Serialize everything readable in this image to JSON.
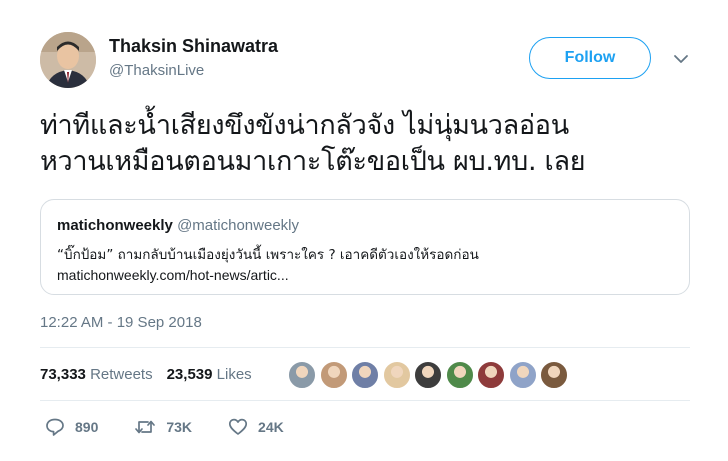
{
  "author": {
    "name": "Thaksin Shinawatra",
    "handle": "@ThaksinLive",
    "avatar_icon": "profile-photo"
  },
  "follow_label": "Follow",
  "tweet": {
    "lines": [
      "ท่าทีและน้ำเสียงขึงขังน่ากลัวจัง ไม่นุ่มนวลอ่อน",
      "หวานเหมือนตอนมาเกาะโต๊ะขอเป็น ผบ.ทบ. เลย"
    ]
  },
  "quote": {
    "name": "matichonweekly",
    "handle": "@matichonweekly",
    "text": "“บิ๊กป้อม” ถามกลับบ้านเมืองยุ่งวันนี้ เพราะใคร ? เอาคดีตัวเองให้รอดก่อน",
    "link": "matichonweekly.com/hot-news/artic..."
  },
  "timestamp": "12:22 AM - 19 Sep 2018",
  "stats": {
    "retweets_count": "73,333",
    "retweets_label": "Retweets",
    "likes_count": "23,539",
    "likes_label": "Likes"
  },
  "likers": [
    {
      "color": "#8a9aa8"
    },
    {
      "color": "#c29a78"
    },
    {
      "color": "#6f7fa6"
    },
    {
      "color": "#e2c8a0"
    },
    {
      "color": "#3d3d3d"
    },
    {
      "color": "#4f8a4a"
    },
    {
      "color": "#8e3b3b"
    },
    {
      "color": "#8fa3c8"
    },
    {
      "color": "#7a5a3e"
    }
  ],
  "actions": {
    "reply_count": "890",
    "retweet_count": "73K",
    "like_count": "24K"
  },
  "colors": {
    "accent": "#1da1f2",
    "muted": "#657786",
    "text": "#14171a",
    "border": "#e6ecf0"
  }
}
